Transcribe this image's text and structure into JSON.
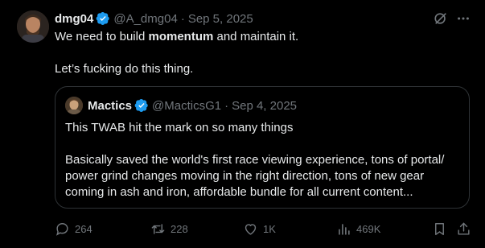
{
  "post": {
    "author_name": "dmg04",
    "handle": "@A_dmg04",
    "separator": "·",
    "date": "Sep 5, 2025",
    "line1_before": "We need to build ",
    "line1_bold": "momentum",
    "line1_after": " and maintain it.",
    "line2": "Let’s fucking do this thing."
  },
  "quote": {
    "author_name": "Mactics",
    "handle": "@MacticsG1",
    "separator": "·",
    "date": "Sep 4, 2025",
    "line1": "This TWAB hit the mark on so many things",
    "line2": "Basically saved the world's first race viewing experience, tons of portal/",
    "line3": "power grind changes moving in the right direction, tons of new gear",
    "line4": "coming in ash and iron, affordable bundle for all current content..."
  },
  "actions": {
    "replies": "264",
    "reposts": "228",
    "likes": "1K",
    "views": "469K"
  },
  "icons": {
    "verified": "verified-badge-icon",
    "grok": "grok-icon",
    "more": "more-icon",
    "reply": "reply-icon",
    "repost": "repost-icon",
    "like": "like-icon",
    "views": "views-icon",
    "bookmark": "bookmark-icon",
    "share": "share-icon"
  },
  "colors": {
    "background": "#000000",
    "text": "#e7e9ea",
    "secondary": "#71767b",
    "verified": "#1d9bf0",
    "border": "#2f3336"
  }
}
